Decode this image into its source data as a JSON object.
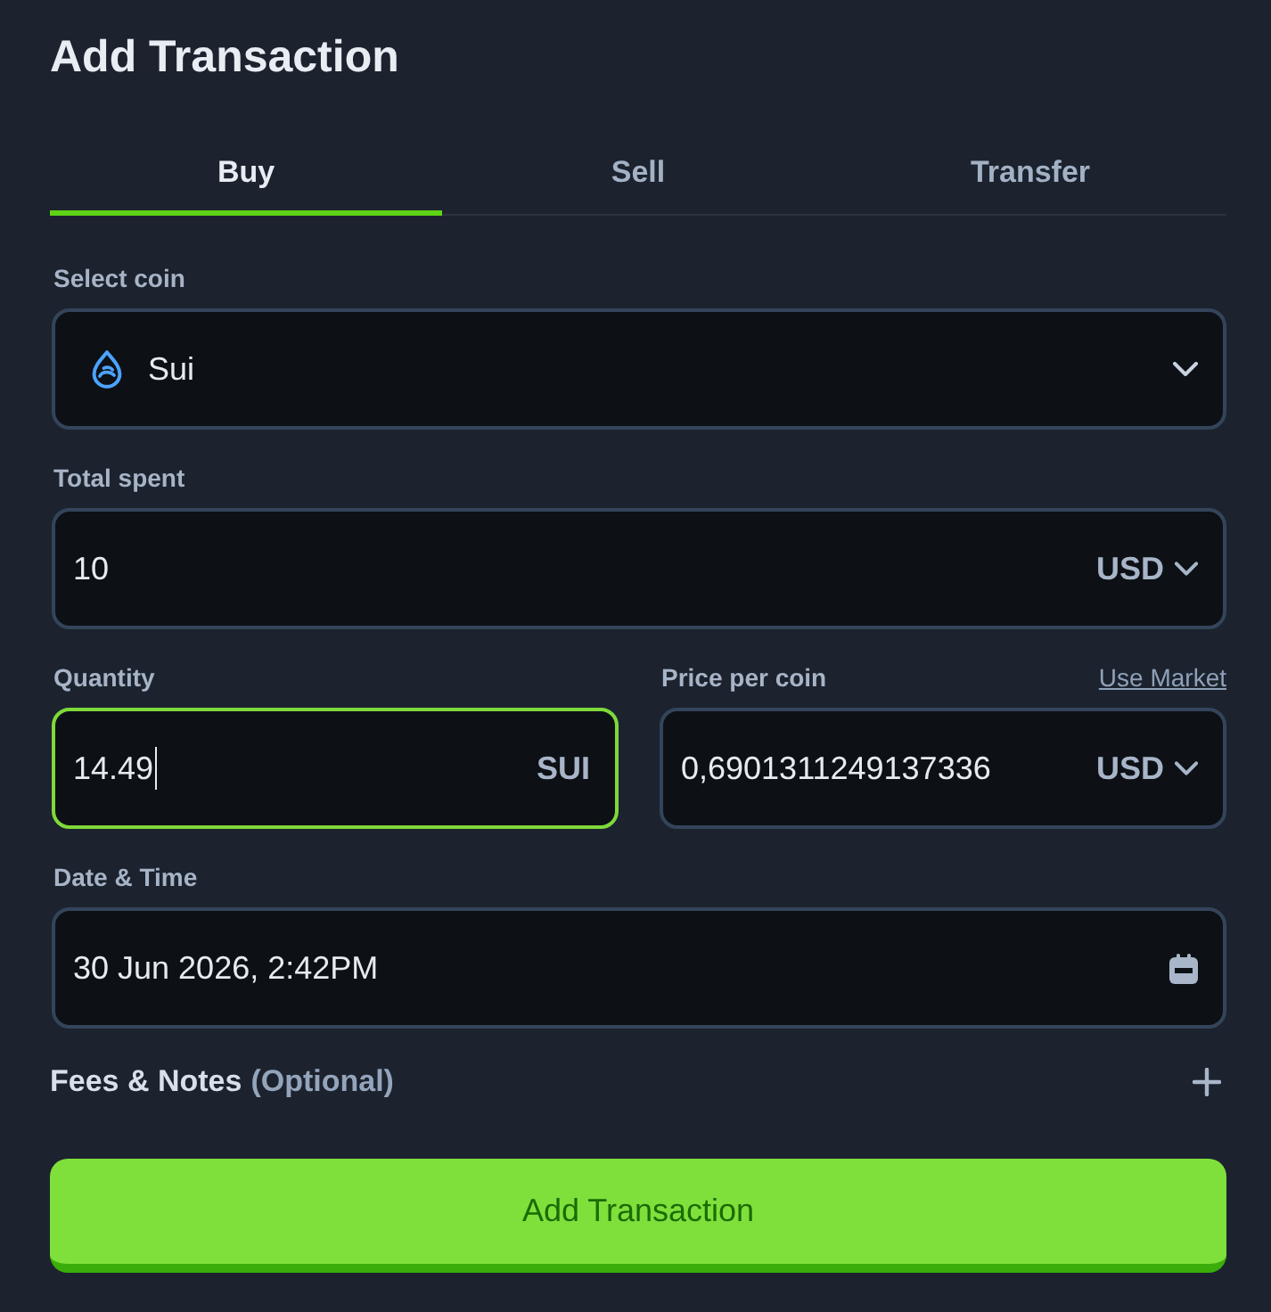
{
  "title": "Add Transaction",
  "tabs": [
    {
      "label": "Buy",
      "selected": true
    },
    {
      "label": "Sell",
      "selected": false
    },
    {
      "label": "Transfer",
      "selected": false
    }
  ],
  "coin_select": {
    "label": "Select coin",
    "value": "Sui",
    "focused": false
  },
  "total_spent": {
    "label": "Total spent",
    "value": "10",
    "currency": "USD",
    "focused": false
  },
  "quantity": {
    "label": "Quantity",
    "value": "14.49",
    "unit": "SUI",
    "focused": true
  },
  "price_per_coin": {
    "label": "Price per coin",
    "link": "Use Market",
    "value": "0,6901311249137336",
    "currency": "USD",
    "focused": false
  },
  "date_time": {
    "label": "Date & Time",
    "value": "30 Jun 2026, 2:42PM",
    "focused": false
  },
  "fees_notes": {
    "label": "Fees & Notes",
    "hint": "(Optional)",
    "expanded": false
  },
  "submit_button": {
    "label": "Add Transaction"
  }
}
